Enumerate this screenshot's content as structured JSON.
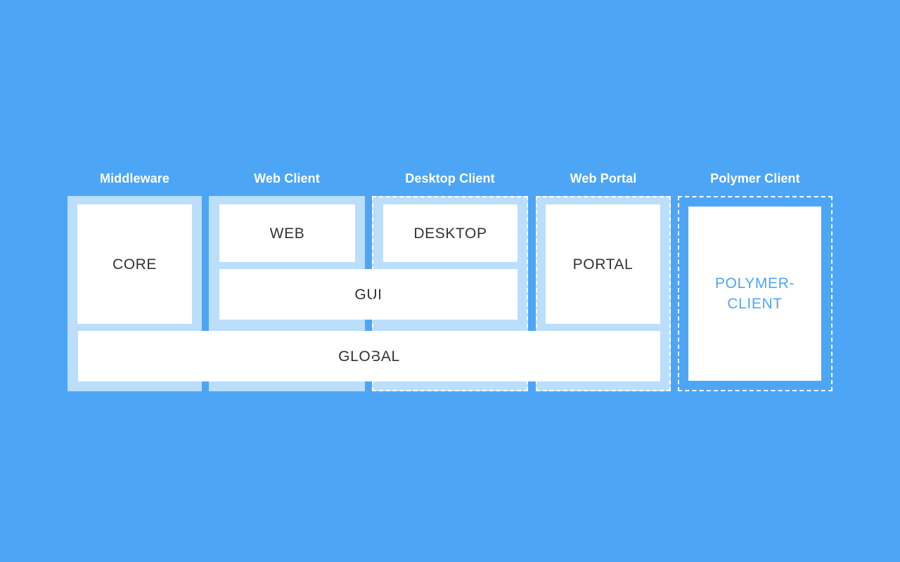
{
  "diagram": {
    "title_bar_color": "#4da6f5",
    "panel_color": "#bbdefb",
    "box_color": "#ffffff",
    "text_color": "#333333",
    "accent_color": "#4da6f5",
    "columns": [
      {
        "id": "middleware",
        "label": "Middleware",
        "dashed": false
      },
      {
        "id": "web-client",
        "label": "Web Client",
        "dashed": false
      },
      {
        "id": "desktop-client",
        "label": "Desktop Client",
        "dashed": true
      },
      {
        "id": "web-portal",
        "label": "Web Portal",
        "dashed": false
      },
      {
        "id": "polymer-client",
        "label": "Polymer Client",
        "dashed": true
      }
    ],
    "boxes": [
      {
        "id": "core",
        "label": "CORE",
        "accent": false
      },
      {
        "id": "web",
        "label": "WEB",
        "accent": false
      },
      {
        "id": "desktop",
        "label": "DESKTOP",
        "accent": false
      },
      {
        "id": "portal",
        "label": "PORTAL",
        "accent": false
      },
      {
        "id": "gui",
        "label": "GUI",
        "accent": false
      },
      {
        "id": "global",
        "label": "GLOBAL",
        "accent": false
      },
      {
        "id": "polymer-client",
        "label": "POLYMER-\nCLIENT",
        "accent": true
      }
    ]
  }
}
